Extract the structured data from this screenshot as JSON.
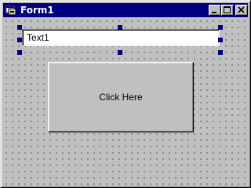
{
  "window": {
    "title": "Form1",
    "icon": "form-icon"
  },
  "titlebar_buttons": {
    "minimize": "minimize-icon",
    "maximize": "maximize-icon",
    "close": "close-icon"
  },
  "form": {
    "textbox": {
      "value": "Text1",
      "selected": true
    },
    "command_button": {
      "label": "Click Here"
    }
  },
  "colors": {
    "titlebar": "#000080",
    "face": "#c0c0c0",
    "handle": "#000080"
  }
}
